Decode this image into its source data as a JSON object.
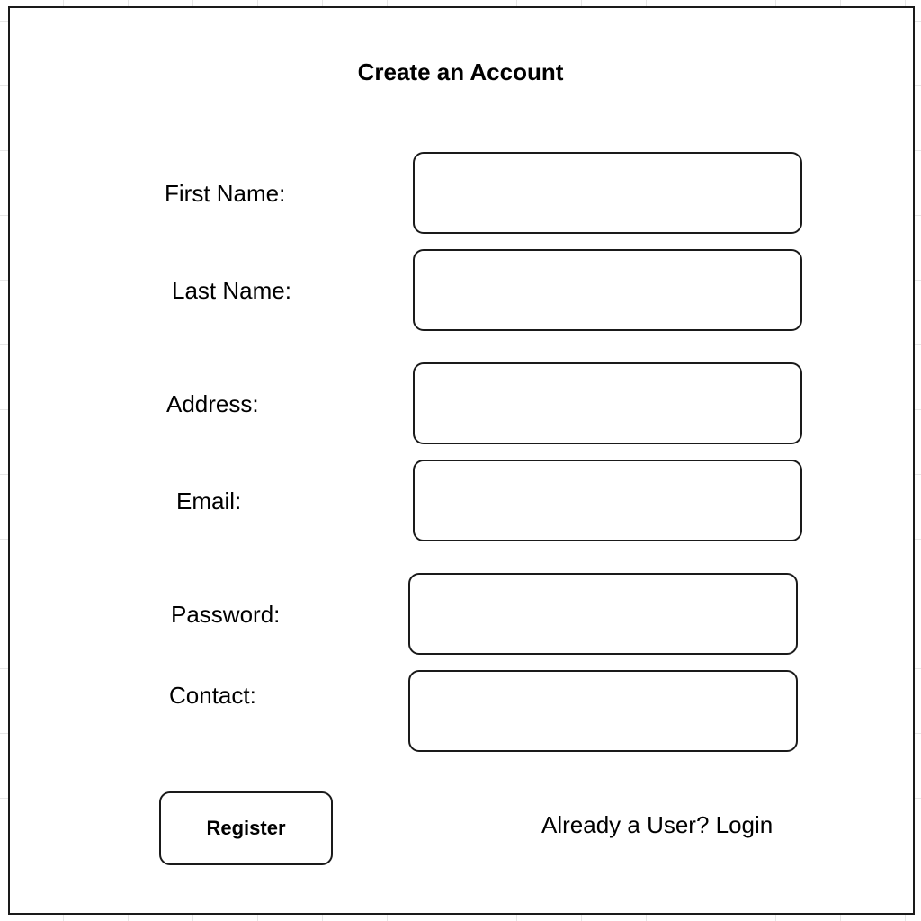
{
  "form": {
    "title": "Create an Account",
    "fields": [
      {
        "label": "First Name:",
        "value": "",
        "placeholder": ""
      },
      {
        "label": "Last Name:",
        "value": "",
        "placeholder": ""
      },
      {
        "label": "Address:",
        "value": "",
        "placeholder": ""
      },
      {
        "label": "Email:",
        "value": "",
        "placeholder": ""
      },
      {
        "label": "Password:",
        "value": "",
        "placeholder": ""
      },
      {
        "label": "Contact:",
        "value": "",
        "placeholder": ""
      }
    ],
    "register_label": "Register",
    "login_prompt": "Already a User? Login"
  }
}
